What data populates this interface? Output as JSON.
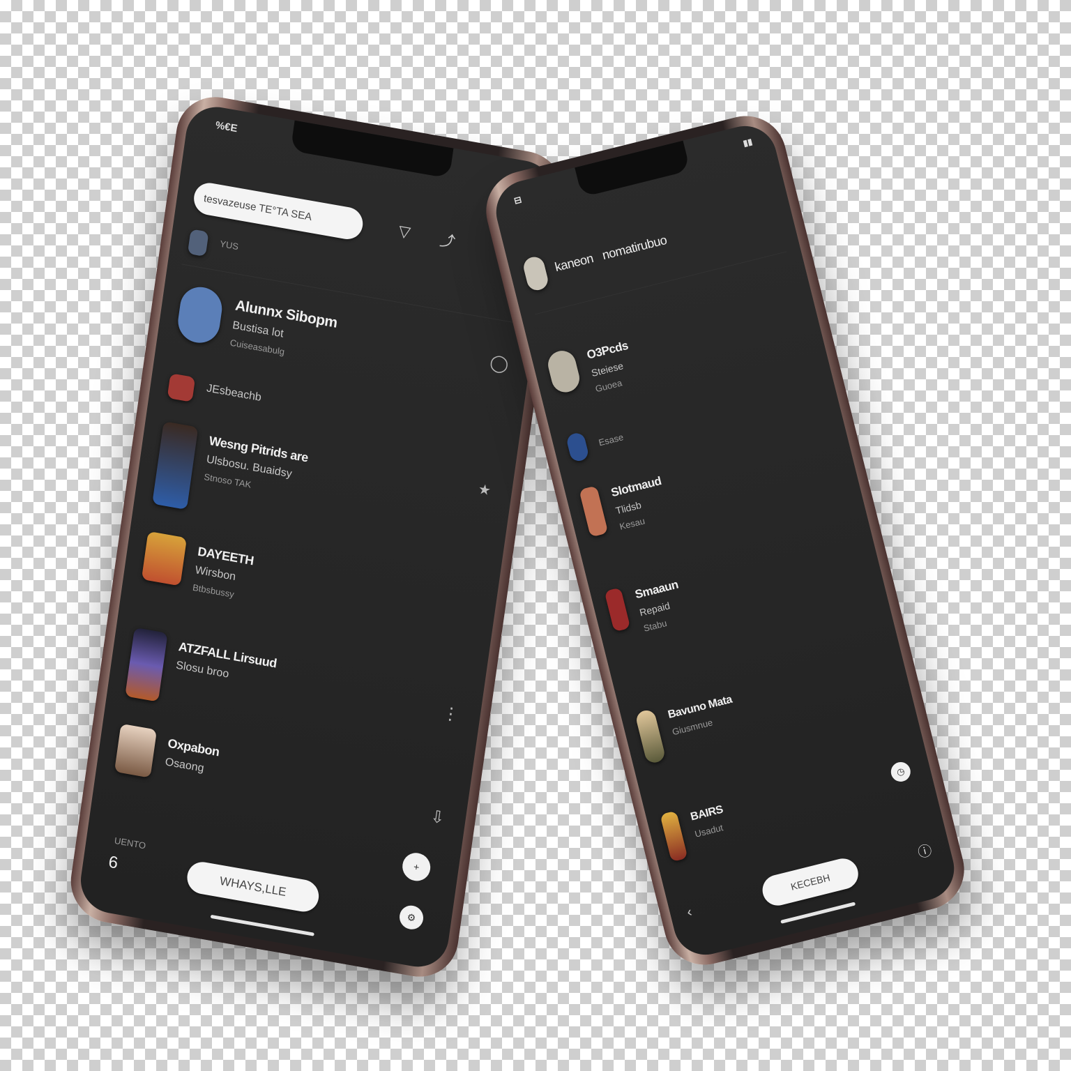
{
  "left_phone": {
    "status_time": "%€E",
    "search": {
      "value": "tesvazeuse TE°TA SEA"
    },
    "header_icons": [
      "filter-icon",
      "share-icon"
    ],
    "section_label": "YUS",
    "items": [
      {
        "title": "Alunnx Sibopm",
        "sub": "Bustisa lot",
        "sub2": "Cuiseasabulg",
        "color": "#5b7fb8"
      },
      {
        "title": "",
        "sub": "JEsbeachb",
        "sub2": "",
        "color": "#a33a35"
      },
      {
        "title": "Wesng Pitrids are",
        "sub": "Ulsbosu. Buaidsy",
        "sub2": "Stnoso TAK",
        "color": "#2e5da8"
      },
      {
        "title": "DAYEETH",
        "sub": "Wirsbon",
        "sub2": "Btbsbussy",
        "color": "#c0502f"
      },
      {
        "title": "ATZFALL Lirsuud",
        "sub": "Slosu broo",
        "sub2": "",
        "color": "#6a5bb0"
      },
      {
        "title": "Oxpabon",
        "sub": "Osaong",
        "sub2": "",
        "color": "#c79c78"
      }
    ],
    "bottom_count": "6",
    "bottom_pill": "WHAYS,LLE",
    "footer_link": "UENTO"
  },
  "right_phone": {
    "header_title": "kaneon",
    "header_title2": "nomatirubuo",
    "items": [
      {
        "title": "O3Pcds",
        "sub": "Steiese",
        "sub2": "Guoea",
        "color": "#b9b3a4"
      },
      {
        "title": "",
        "sub": "Esase",
        "sub2": "",
        "color": "#2c4f8f"
      },
      {
        "title": "Slotmaud",
        "sub": "Tlidsb",
        "sub2": "Kesau",
        "color": "#c27254"
      },
      {
        "title": "Smaaun",
        "sub": "Repaid",
        "sub2": "Stabu",
        "color": "#9b2a2a"
      },
      {
        "title": "Bavuno Mata",
        "sub": "Giusmnue",
        "sub2": "",
        "color": "#b39a63"
      },
      {
        "title": "BAIRS",
        "sub": "Usadut",
        "sub2": "",
        "color": "#8a2d23"
      }
    ],
    "bottom_pill": "KECEBH"
  }
}
